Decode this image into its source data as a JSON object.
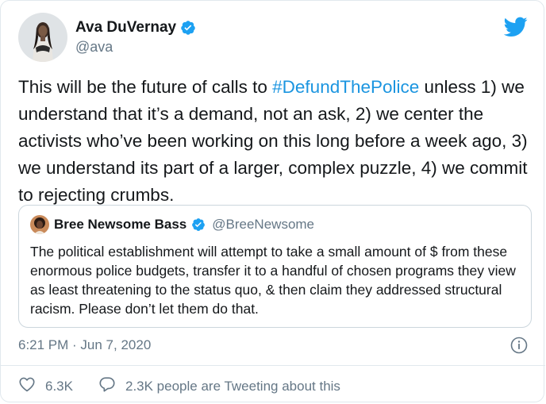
{
  "author": {
    "display_name": "Ava DuVernay",
    "handle": "@ava"
  },
  "tweet": {
    "text_before": "This will be the future of calls to ",
    "hashtag": "#DefundThePolice",
    "text_after": " unless 1) we understand that it’s a demand, not an ask, 2) we center the activists who’ve been working on this long before a week ago, 3) we understand its part of a larger, complex puzzle, 4) we commit to rejecting crumbs."
  },
  "quoted_tweet": {
    "display_name": "Bree Newsome Bass",
    "handle": "@BreeNewsome",
    "text": "The political establishment will attempt to take a small amount of $ from these enormous police budgets, transfer it to a handful of chosen programs they view as least threatening to the status quo, & then claim they addressed structural racism. Please don’t let them do that."
  },
  "meta": {
    "timestamp": "6:21 PM · Jun 7, 2020"
  },
  "actions": {
    "likes": "6.3K",
    "conversation": "2.3K people are Tweeting about this"
  },
  "colors": {
    "link": "#1b95e0",
    "twitter_blue": "#1da1f2",
    "secondary_text": "#657786"
  },
  "icons": {
    "brand": "twitter-bird-icon",
    "verified": "verified-badge-icon",
    "info": "info-icon",
    "like": "heart-icon",
    "reply": "speech-bubble-icon"
  }
}
